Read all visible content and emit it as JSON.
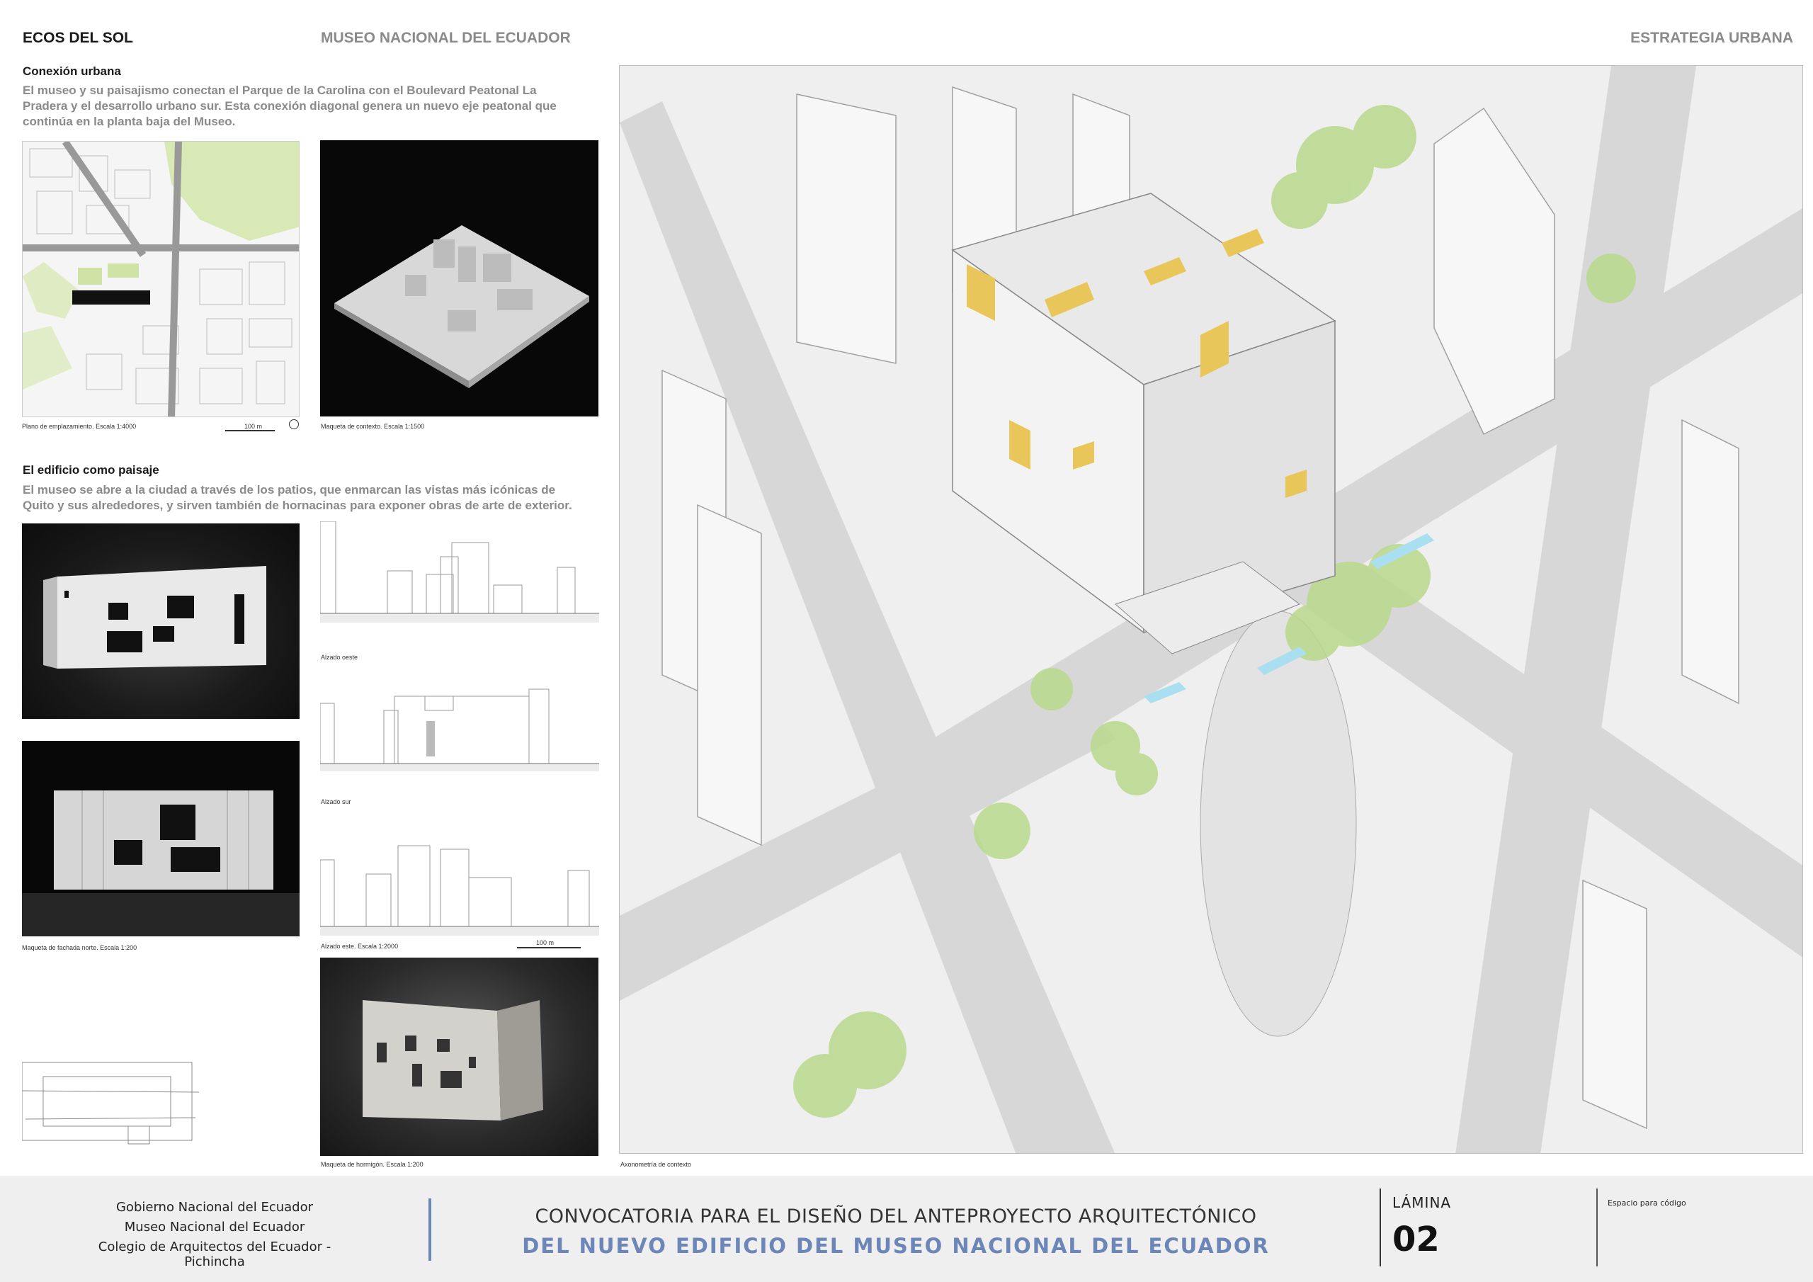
{
  "header": {
    "project": "ECOS DEL SOL",
    "museum": "MUSEO NACIONAL DEL ECUADOR",
    "section": "ESTRATEGIA URBANA"
  },
  "section1": {
    "title": "Conexión urbana",
    "body_lines": [
      "El museo y su paisajismo conectan el Parque de la Carolina con el Boulevard Peatonal La",
      "Pradera y el desarrollo urbano sur. Esta conexión diagonal genera un nuevo eje peatonal que",
      "continúa en la planta baja del Museo."
    ]
  },
  "section2": {
    "title": "El edificio como paisaje",
    "body_lines": [
      "El museo se abre a la ciudad a través de los patios, que enmarcan las vistas más icónicas de",
      "Quito y sus alrededores, y sirven también de hornacinas para exponer obras de arte de exterior."
    ]
  },
  "captions": {
    "site_plan": "Plano de emplazamiento. Escala 1:4000",
    "site_plan_scale": "100 m",
    "context_model": "Maqueta de contexto. Escala 1:1500",
    "north_facade": "Maqueta de fachada norte. Escala 1:200",
    "west_elev": "Alzado oeste",
    "south_elev": "Alzado sur",
    "east_elev": "Alzado este. Escala 1:2000",
    "east_elev_scale": "100 m",
    "concrete_model": "Maqueta de hormigón. Escala 1:200",
    "axonometry": "Axonometría de contexto"
  },
  "footer": {
    "org1": "Gobierno Nacional del Ecuador",
    "org2": "Museo Nacional del Ecuador",
    "org3": "Colegio de Arquitectos del Ecuador - Pichincha",
    "conv_line1": "CONVOCATORIA PARA EL DISEÑO DEL ANTEPROYECTO ARQUITECTÓNICO",
    "conv_line2": "DEL NUEVO EDIFICIO DEL MUSEO NACIONAL DEL ECUADOR",
    "sheet_label": "LÁMINA",
    "sheet_number": "02",
    "code_label": "Espacio para código"
  },
  "colors": {
    "accent_blue": "#6c86b8",
    "muted_gray": "#8a8a8a",
    "tree_green": "#b9d98c",
    "patio_yellow": "#e8c65a",
    "water_blue": "#a9dff0"
  }
}
